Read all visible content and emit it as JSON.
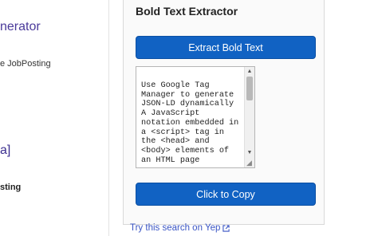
{
  "background_page": {
    "heading_fragment": "nerator",
    "sub_fragment": "e JobPosting",
    "link_fragment": "a]",
    "posting_fragment": "sting"
  },
  "extension_panel": {
    "title": "Bold Text Extractor",
    "extract_button_label": "Extract Bold Text",
    "textarea_value": "Use Google Tag\nManager to generate\nJSON-LD dynamically\nA JavaScript\nnotation embedded in\na <script> tag in\nthe <head> and\n<body> elements of\nan HTML page",
    "copy_button_label": "Click to Copy"
  },
  "footer": {
    "yep_link_label": "Try this search on Yep",
    "yep_link_icon": "external-link-icon"
  },
  "colors": {
    "button_blue": "#1162c3",
    "heading_purple": "#4a3a9a",
    "link_blue": "#3a55c4"
  }
}
